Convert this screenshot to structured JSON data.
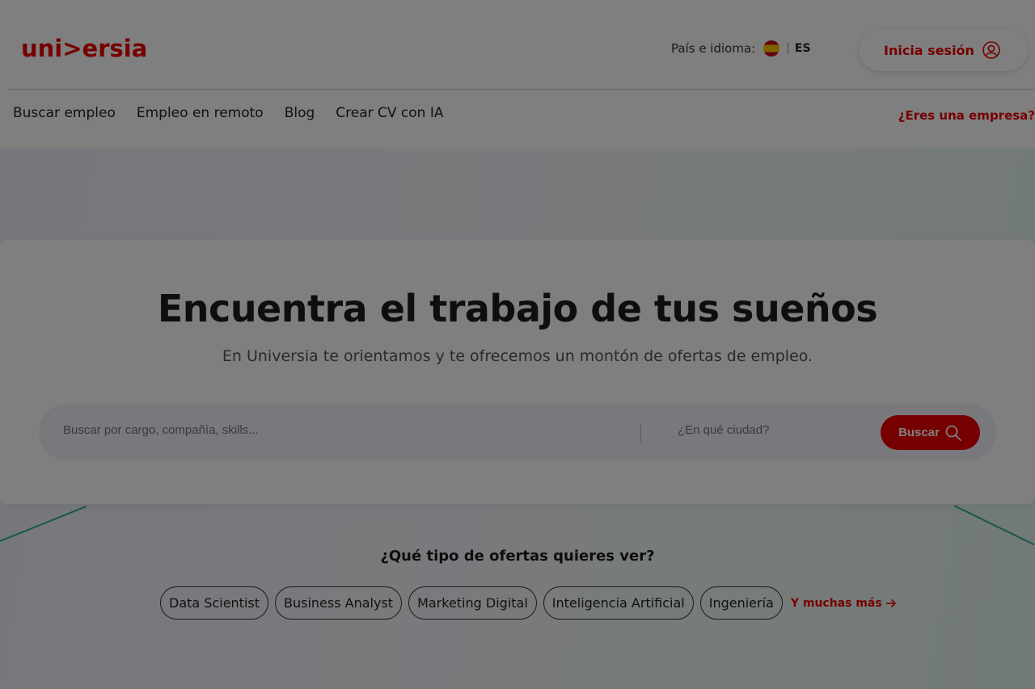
{
  "brand": {
    "logo_text": "uni>ersia",
    "accent": "#ec0000"
  },
  "header": {
    "lang_label": "País e idioma:",
    "lang_code": "ES",
    "login_label": "Inicia sesión",
    "nav": [
      "Buscar empleo",
      "Empleo en remoto",
      "Blog",
      "Crear CV con IA"
    ],
    "company_link": "¿Eres una empresa?"
  },
  "hero": {
    "title": "Encuentra el trabajo de tus sueños",
    "subtitle": "En Universia te orientamos y te ofrecemos un montón de ofertas de empleo."
  },
  "search": {
    "placeholder": "Buscar por cargo, compañía, skills...",
    "city_placeholder": "¿En qué ciudad?",
    "button_label": "Buscar"
  },
  "offers": {
    "question": "¿Qué tipo de ofertas quieres ver?",
    "chips": [
      "Data Scientist",
      "Business Analyst",
      "Marketing Digital",
      "Inteligencia Artificial",
      "Ingeniería"
    ],
    "more_label": "Y muchas más"
  }
}
